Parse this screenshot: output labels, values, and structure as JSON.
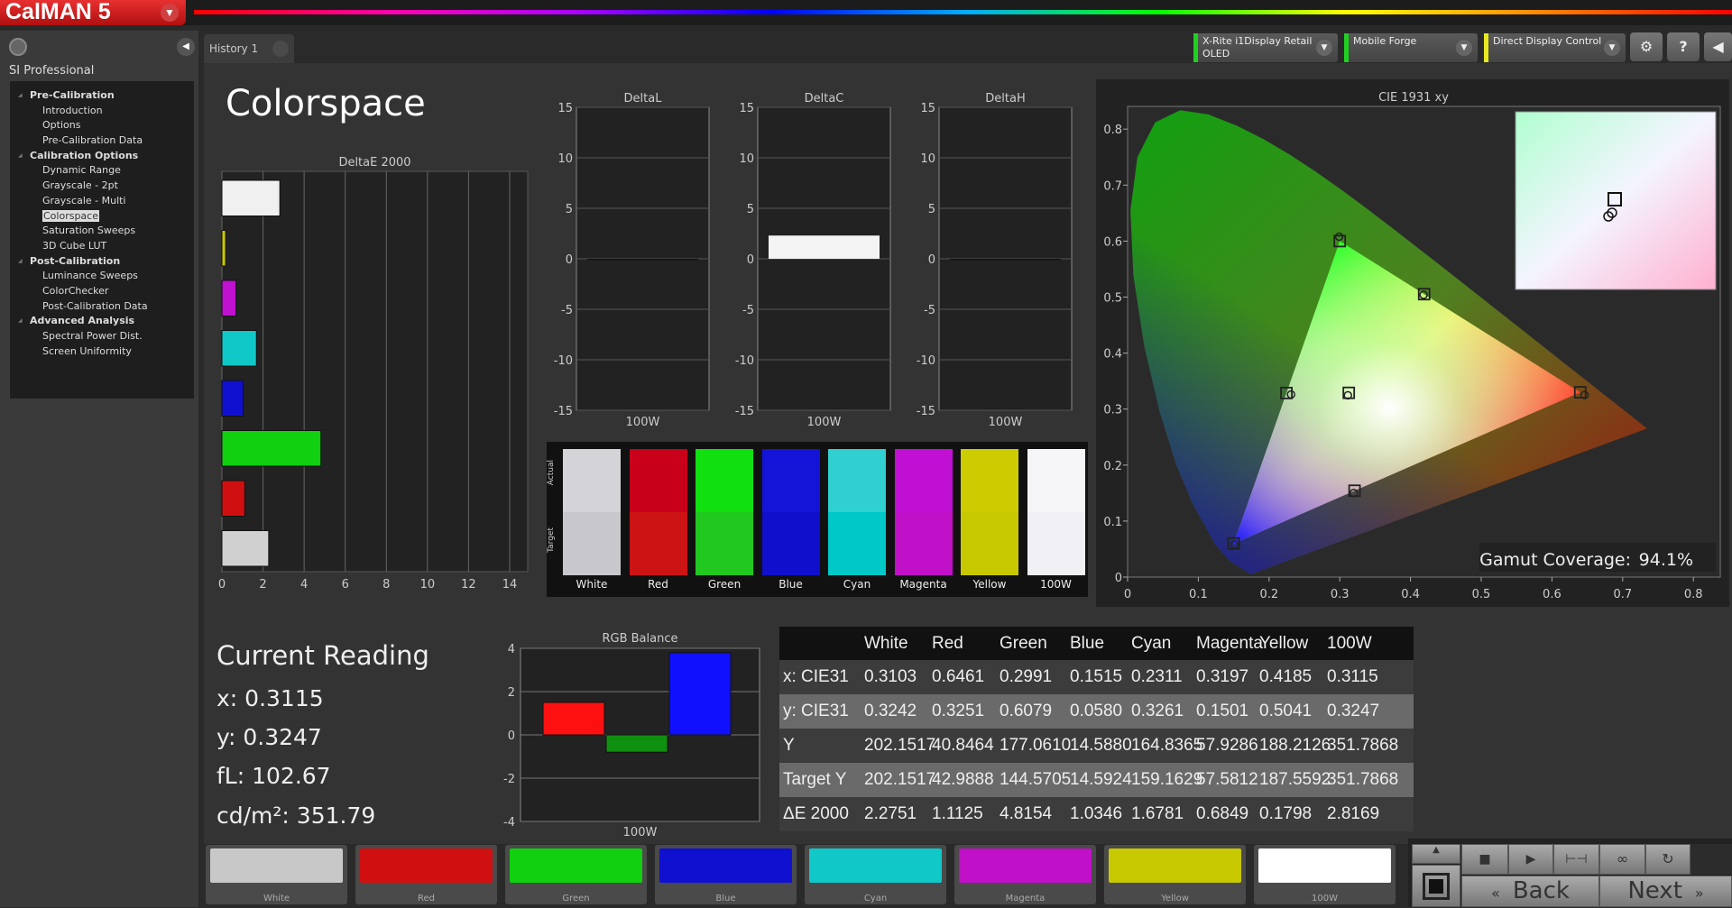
{
  "app": {
    "logo": "CalMAN 5",
    "tab": "History 1"
  },
  "sidebar": {
    "title": "SI Professional",
    "items": [
      {
        "label": "Pre-Calibration",
        "type": "h"
      },
      {
        "label": "Introduction",
        "type": "c"
      },
      {
        "label": "Options",
        "type": "c"
      },
      {
        "label": "Pre-Calibration Data",
        "type": "c"
      },
      {
        "label": "Calibration Options",
        "type": "h"
      },
      {
        "label": "Dynamic Range",
        "type": "c"
      },
      {
        "label": "Grayscale - 2pt",
        "type": "c"
      },
      {
        "label": "Grayscale - Multi",
        "type": "c"
      },
      {
        "label": "Colorspace",
        "type": "c",
        "selected": true
      },
      {
        "label": "Saturation Sweeps",
        "type": "c"
      },
      {
        "label": "3D Cube LUT",
        "type": "c"
      },
      {
        "label": "Post-Calibration",
        "type": "h"
      },
      {
        "label": "Luminance Sweeps",
        "type": "c"
      },
      {
        "label": "ColorChecker",
        "type": "c"
      },
      {
        "label": "Post-Calibration Data",
        "type": "c"
      },
      {
        "label": "Advanced Analysis",
        "type": "h"
      },
      {
        "label": "Spectral Power Dist.",
        "type": "c"
      },
      {
        "label": "Screen Uniformity",
        "type": "c"
      }
    ]
  },
  "devices": [
    {
      "line1": "X-Rite i1Display Retail",
      "line2": "OLED",
      "status": "#20d020"
    },
    {
      "line1": "Mobile Forge",
      "line2": "",
      "status": "#20d020"
    },
    {
      "line1": "Direct Display Control",
      "line2": "",
      "status": "#e8e820"
    }
  ],
  "toolbar": {
    "settings": "⚙",
    "help": "?",
    "collapse": "◀"
  },
  "page": {
    "title": "Colorspace"
  },
  "chart_data": [
    {
      "id": "deltae",
      "type": "bar",
      "orientation": "horizontal",
      "title": "DeltaE 2000",
      "categories": [
        "100W",
        "Yellow",
        "Magenta",
        "Cyan",
        "Blue",
        "Green",
        "Red",
        "White"
      ],
      "values": [
        2.8169,
        0.1798,
        0.6849,
        1.6781,
        1.0346,
        4.8154,
        1.1125,
        2.2751
      ],
      "colors": [
        "#f0f0f0",
        "#c8c800",
        "#c010d0",
        "#10c8c8",
        "#1010d0",
        "#10d010",
        "#d01010",
        "#d0d0d0"
      ],
      "xlim": [
        0,
        15
      ],
      "ticks": [
        "0",
        "2",
        "4",
        "6",
        "8",
        "10",
        "12",
        "14"
      ]
    },
    {
      "id": "deltal",
      "type": "bar",
      "title": "DeltaL",
      "categories": [
        "100W"
      ],
      "values": [
        0
      ],
      "ylim": [
        -15,
        15
      ],
      "ticks": [
        "15",
        "10",
        "5",
        "0",
        "-5",
        "-10",
        "-15"
      ]
    },
    {
      "id": "deltac",
      "type": "bar",
      "title": "DeltaC",
      "categories": [
        "100W"
      ],
      "values": [
        2.3
      ],
      "ylim": [
        -15,
        15
      ],
      "ticks": [
        "15",
        "10",
        "5",
        "0",
        "-5",
        "-10",
        "-15"
      ]
    },
    {
      "id": "deltah",
      "type": "bar",
      "title": "DeltaH",
      "categories": [
        "100W"
      ],
      "values": [
        0
      ],
      "ylim": [
        -15,
        15
      ],
      "ticks": [
        "15",
        "10",
        "5",
        "0",
        "-5",
        "-10",
        "-15"
      ]
    },
    {
      "id": "rgb",
      "type": "bar",
      "title": "RGB Balance",
      "categories": [
        "100W"
      ],
      "series": [
        {
          "values": [
            1.5
          ],
          "color": "#ff1010"
        },
        {
          "values": [
            -0.8
          ],
          "color": "#109010"
        },
        {
          "values": [
            3.8
          ],
          "color": "#1010ff"
        }
      ],
      "ylim": [
        -4,
        4
      ],
      "ticks": [
        "4",
        "2",
        "0",
        "-2",
        "-4"
      ]
    },
    {
      "id": "cie",
      "type": "scatter",
      "title": "CIE 1931 xy",
      "xlim": [
        0,
        0.8
      ],
      "ylim": [
        0,
        0.8
      ],
      "xticks": [
        "0",
        "0.1",
        "0.2",
        "0.3",
        "0.4",
        "0.5",
        "0.6",
        "0.7",
        "0.8"
      ],
      "yticks": [
        "0.8",
        "0.7",
        "0.6",
        "0.5",
        "0.4",
        "0.3",
        "0.2",
        "0.1",
        "0"
      ],
      "targets": [
        [
          0.64,
          0.33
        ],
        [
          0.3,
          0.6
        ],
        [
          0.15,
          0.06
        ],
        [
          0.2246,
          0.3287
        ],
        [
          0.3209,
          0.1542
        ],
        [
          0.4193,
          0.5053
        ],
        [
          0.3127,
          0.329
        ]
      ],
      "measured": [
        [
          0.6461,
          0.3251
        ],
        [
          0.2991,
          0.6079
        ],
        [
          0.1515,
          0.058
        ],
        [
          0.2311,
          0.3261
        ],
        [
          0.3197,
          0.1501
        ],
        [
          0.4185,
          0.5041
        ],
        [
          0.3115,
          0.3247
        ]
      ],
      "gamut_label": "Gamut Coverage:",
      "gamut_value": "94.1%"
    }
  ],
  "swatches": {
    "actual_label": "Actual",
    "target_label": "Target",
    "items": [
      {
        "label": "White",
        "actual": "#d4d4d8",
        "target": "#c8c8cc"
      },
      {
        "label": "Red",
        "actual": "#c8001a",
        "target": "#cc1414"
      },
      {
        "label": "Green",
        "actual": "#10e010",
        "target": "#20c820"
      },
      {
        "label": "Blue",
        "actual": "#1414d8",
        "target": "#1010cc"
      },
      {
        "label": "Cyan",
        "actual": "#30d0d0",
        "target": "#00c8c8"
      },
      {
        "label": "Magenta",
        "actual": "#c010d4",
        "target": "#c010c8"
      },
      {
        "label": "Yellow",
        "actual": "#cccc00",
        "target": "#c8c800"
      },
      {
        "label": "100W",
        "actual": "#f6f6f8",
        "target": "#f0f0f4"
      }
    ]
  },
  "reading": {
    "title": "Current Reading",
    "x": "x: 0.3115",
    "y": "y: 0.3247",
    "fl": "fL: 102.67",
    "cdm2": "cd/m²: 351.79"
  },
  "table": {
    "headers": [
      "",
      "White",
      "Red",
      "Green",
      "Blue",
      "Cyan",
      "Magenta",
      "Yellow",
      "100W"
    ],
    "rows": [
      [
        "x: CIE31",
        "0.3103",
        "0.6461",
        "0.2991",
        "0.1515",
        "0.2311",
        "0.3197",
        "0.4185",
        "0.3115"
      ],
      [
        "y: CIE31",
        "0.3242",
        "0.3251",
        "0.6079",
        "0.0580",
        "0.3261",
        "0.1501",
        "0.5041",
        "0.3247"
      ],
      [
        "Y",
        "202.1517",
        "40.8464",
        "177.0610",
        "14.5880",
        "164.8365",
        "57.9286",
        "188.2126",
        "351.7868"
      ],
      [
        "Target Y",
        "202.1517",
        "42.9888",
        "144.5705",
        "14.5924",
        "159.1629",
        "57.5812",
        "187.5592",
        "351.7868"
      ],
      [
        "ΔE 2000",
        "2.2751",
        "1.1125",
        "4.8154",
        "1.0346",
        "1.6781",
        "0.6849",
        "0.1798",
        "2.8169"
      ]
    ]
  },
  "bottom": {
    "swatches": [
      {
        "label": "White",
        "color": "#c8c8c8"
      },
      {
        "label": "Red",
        "color": "#d01010"
      },
      {
        "label": "Green",
        "color": "#10d010"
      },
      {
        "label": "Blue",
        "color": "#1010d0"
      },
      {
        "label": "Cyan",
        "color": "#10c8c8"
      },
      {
        "label": "Magenta",
        "color": "#c010c8"
      },
      {
        "label": "Yellow",
        "color": "#c8c800"
      },
      {
        "label": "100W",
        "color": "#ffffff"
      }
    ],
    "back": "Back",
    "next": "Next"
  }
}
